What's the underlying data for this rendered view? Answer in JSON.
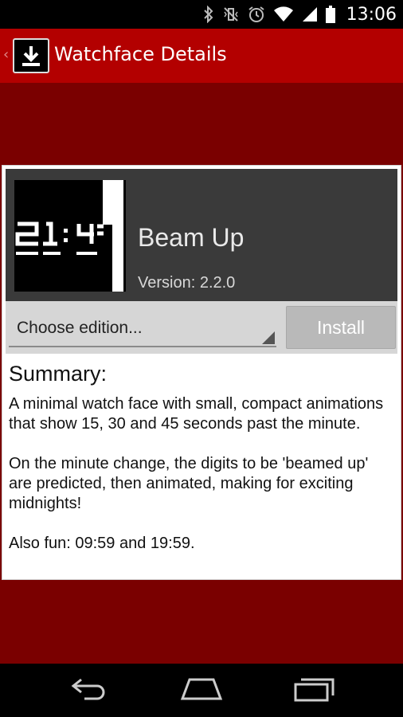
{
  "status_bar": {
    "time": "13:06",
    "icons": [
      "bluetooth-icon",
      "vibrate-icon",
      "alarm-icon",
      "wifi-icon",
      "signal-icon",
      "battery-icon"
    ]
  },
  "action_bar": {
    "title": "Watchface Details",
    "up_indicator": "‹",
    "color": "#b30000"
  },
  "watchface": {
    "name": "Beam Up",
    "version": "Version: 2.2.0",
    "thumbnail_time": "21:4"
  },
  "controls": {
    "edition_placeholder": "Choose edition...",
    "install_label": "Install"
  },
  "summary": {
    "title": "Summary:",
    "paragraphs": [
      "A minimal watch face with small, compact animations that show 15, 30 and 45 seconds past the minute.",
      "On the minute change, the digits to be 'beamed up' are predicted, then animated, making for exciting midnights!",
      "Also fun: 09:59 and 19:59."
    ]
  },
  "nav_bar": {
    "icons": [
      "back-icon",
      "home-icon",
      "recents-icon"
    ]
  },
  "colors": {
    "background": "#7a0000",
    "action_bar": "#b30000",
    "card_header": "#3a3a3a"
  }
}
